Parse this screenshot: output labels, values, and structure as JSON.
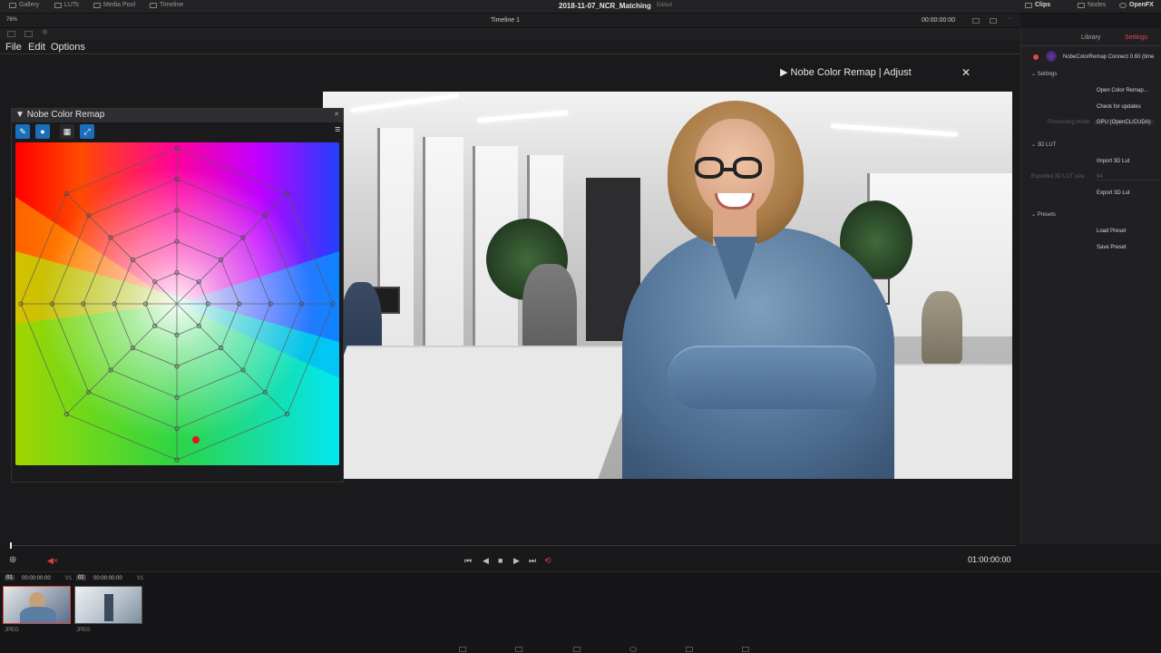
{
  "topbar": {
    "gallery": "Gallery",
    "luts": "LUTs",
    "media_pool": "Media Pool",
    "timeline": "Timeline",
    "project_title": "2018-11-07_NCR_Matching",
    "edited": "Edited",
    "clips": "Clips",
    "nodes": "Nodes",
    "openfx": "OpenFX"
  },
  "viewer_bar": {
    "zoom": "76%",
    "timeline_name": "Timeline 1",
    "timecode": "00:00:00:00"
  },
  "plugin_menu": {
    "file": "File",
    "edit": "Edit",
    "options": "Options"
  },
  "adjust_window": {
    "title": "Nobe Color Remap | Adjust",
    "close": "✕"
  },
  "panel": {
    "title": "Nobe Color Remap",
    "tools": [
      "brush-icon",
      "circle-icon",
      "grid-icon",
      "expand-icon"
    ],
    "menu": "≡"
  },
  "sidebar": {
    "tab_library": "Library",
    "tab_settings": "Settings",
    "plugin_name": "NobeColorRemap Connect 0.60 (time",
    "settings": "Settings",
    "open_button": "Open Color Remap...",
    "check_updates": "Check for updates",
    "processing_mode_label": "Processing mode",
    "processing_mode_value": "GPU (OpenCL/CUDA)",
    "lut_section": "3D LUT",
    "import_lut": "Import 3D Lut",
    "lut_size_label": "Exported 3D LUT size",
    "lut_size_value": "64",
    "export_lut": "Export 3D Lut",
    "presets_section": "Presets",
    "load_preset": "Load Preset",
    "save_preset": "Save Preset"
  },
  "transport": {
    "timecode": "01:00:00:00"
  },
  "clips": [
    {
      "num": "01",
      "timecode": "00:00:00:00",
      "track": "V1",
      "type": "JPEG"
    },
    {
      "num": "02",
      "timecode": "00:00:00:00",
      "track": "V1",
      "type": "JPEG"
    }
  ],
  "colors": {
    "accent_blue": "#1a6fb8",
    "loop_red": "#d9443a"
  }
}
